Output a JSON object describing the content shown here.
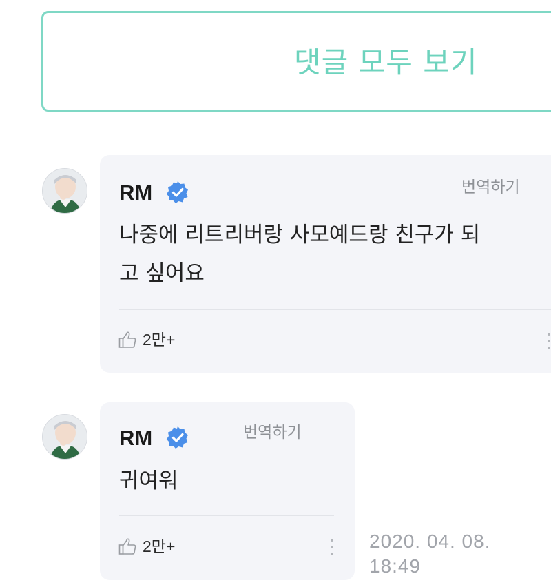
{
  "view_all": {
    "label": "댓글 모두 보기"
  },
  "comments": [
    {
      "author": "RM",
      "verified": true,
      "translate_label": "번역하기",
      "text_lines": [
        "나중에 리트리버랑 사모예드랑 친구가 되",
        "고 싶어요"
      ],
      "likes": "2만+"
    },
    {
      "author": "RM",
      "verified": true,
      "translate_label": "번역하기",
      "text_lines": [
        "귀여워"
      ],
      "likes": "2만+",
      "timestamp_lines": [
        "2020. 04. 08.",
        "18:49"
      ]
    }
  ],
  "colors": {
    "accent": "#6dd3bd",
    "verified_badge": "#4b8fe9",
    "card_bg": "#f4f5f9"
  },
  "icons": [
    "verified-badge-icon",
    "thumbs-up-icon",
    "more-vertical-icon",
    "avatar-photo"
  ]
}
